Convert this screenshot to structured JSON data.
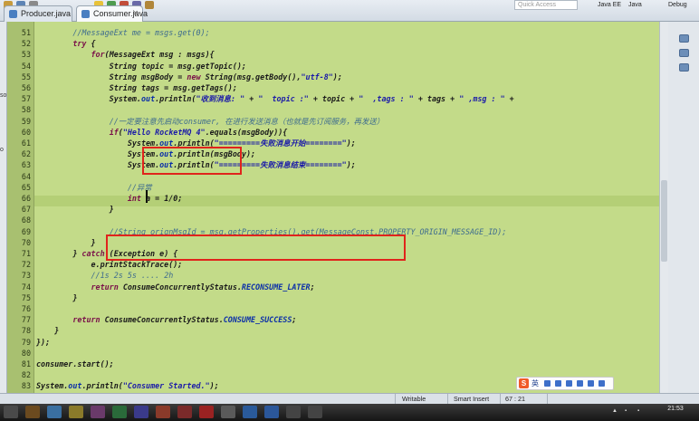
{
  "tabs": [
    {
      "label": "Producer.java",
      "active": false
    },
    {
      "label": "Consumer.java",
      "active": true
    }
  ],
  "toolbar": {
    "quick_access": "Quick Access",
    "perspectives": [
      "Java EE",
      "Java",
      "Debug"
    ]
  },
  "left_strip": {
    "labels": [
      "so",
      "o"
    ]
  },
  "editor": {
    "lines": [
      {
        "no": "51",
        "text": "        //MessageExt me = msgs.get(0);"
      },
      {
        "no": "52",
        "text": "        try {"
      },
      {
        "no": "53",
        "text": "            for(MessageExt msg : msgs){"
      },
      {
        "no": "54",
        "text": "                String topic = msg.getTopic();"
      },
      {
        "no": "55",
        "text": "                String msgBody = new String(msg.getBody(),\"utf-8\");"
      },
      {
        "no": "56",
        "text": "                String tags = msg.getTags();"
      },
      {
        "no": "57",
        "text": "                System.out.println(\"收到消息: \" + \"  topic :\" + topic + \"  ,tags : \" + tags + \" ,msg : \" +"
      },
      {
        "no": "58",
        "text": ""
      },
      {
        "no": "59",
        "text": "                //一定要注意先启动consumer, 在进行发送消息（也就是先订阅服务，再发送）"
      },
      {
        "no": "60",
        "text": "                if(\"Hello RocketMQ 4\".equals(msgBody)){"
      },
      {
        "no": "61",
        "text": "                    System.out.println(\"=========失败消息开始========\");"
      },
      {
        "no": "62",
        "text": "                    System.out.println(msgBody);"
      },
      {
        "no": "63",
        "text": "                    System.out.println(\"=========失败消息结束========\");"
      },
      {
        "no": "64",
        "text": ""
      },
      {
        "no": "65",
        "text": "                    //异常"
      },
      {
        "no": "66",
        "text": "                    int a = 1/0;"
      },
      {
        "no": "67",
        "text": "                }"
      },
      {
        "no": "68",
        "text": ""
      },
      {
        "no": "69",
        "text": "                //String orignMsgId = msg.getProperties().get(MessageConst.PROPERTY_ORIGIN_MESSAGE_ID);"
      },
      {
        "no": "70",
        "text": "            }"
      },
      {
        "no": "71",
        "text": "        } catch (Exception e) {"
      },
      {
        "no": "72",
        "text": "            e.printStackTrace();"
      },
      {
        "no": "73",
        "text": "            //1s 2s 5s .... 2h"
      },
      {
        "no": "74",
        "text": "            return ConsumeConcurrentlyStatus.RECONSUME_LATER;"
      },
      {
        "no": "75",
        "text": "        }"
      },
      {
        "no": "76",
        "text": ""
      },
      {
        "no": "77",
        "text": "        return ConsumeConcurrentlyStatus.CONSUME_SUCCESS;"
      },
      {
        "no": "78",
        "text": "    }"
      },
      {
        "no": "79",
        "text": "});"
      },
      {
        "no": "80",
        "text": ""
      },
      {
        "no": "81",
        "text": "consumer.start();"
      },
      {
        "no": "82",
        "text": ""
      },
      {
        "no": "83",
        "text": "System.out.println(\"Consumer Started.\");"
      }
    ]
  },
  "status": {
    "writable": "Writable",
    "insert_mode": "Smart Insert",
    "position": "67 : 21"
  },
  "ime": {
    "label": "英"
  },
  "clock": {
    "time": "21:53"
  },
  "colors": {
    "editor_bg": "#c3db89",
    "highlight_box": "#e0241c",
    "keyword": "#7a1149",
    "string": "#1b1ba8",
    "comment": "#3e6c8e"
  }
}
